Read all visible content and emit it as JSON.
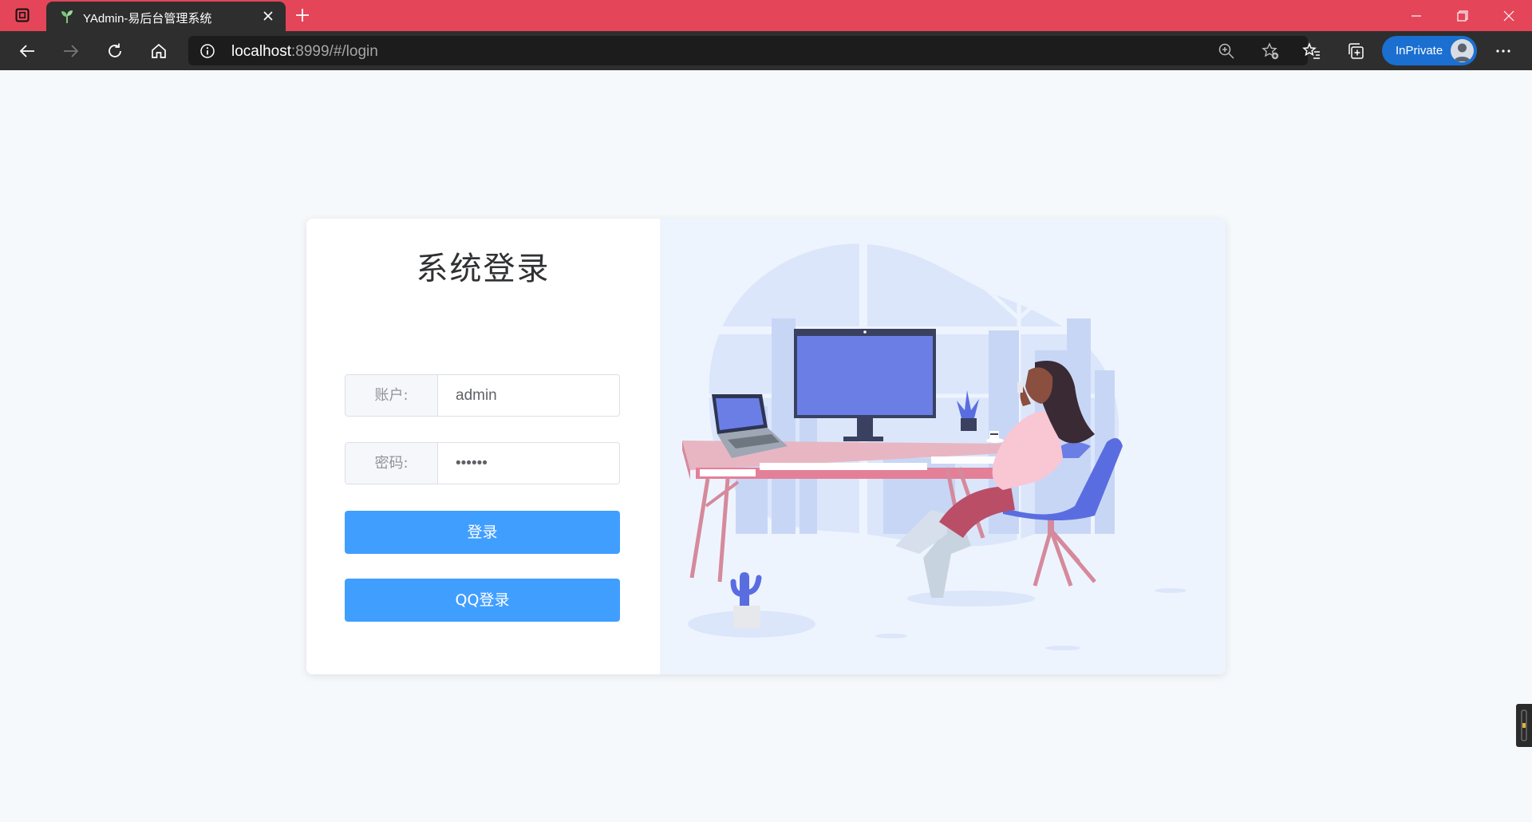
{
  "browser": {
    "tab_title": "YAdmin-易后台管理系统",
    "url_host": "localhost",
    "url_rest": ":8999/#/login",
    "inprivate_label": "InPrivate"
  },
  "login": {
    "title": "系统登录",
    "account_label": "账户:",
    "account_value": "admin",
    "password_label": "密码:",
    "password_value": "••••••",
    "login_button": "登录",
    "qq_login_button": "QQ登录"
  },
  "colors": {
    "titlebar": "#e44558",
    "toolbar": "#2e2e2e",
    "primary_button": "#409eff",
    "illustration_bg": "#eef4fe",
    "monitor_screen": "#6b7ee6"
  },
  "icons": {
    "window_menu": "window-menu-icon",
    "favicon": "sprout-icon",
    "close_tab": "close-icon",
    "new_tab": "plus-icon",
    "back": "arrow-left-icon",
    "forward": "arrow-right-icon",
    "refresh": "refresh-icon",
    "home": "home-icon",
    "site_info": "info-icon",
    "zoom": "zoom-in-icon",
    "add_favorite": "star-add-icon",
    "favorites": "favorites-icon",
    "collections": "collections-icon",
    "more": "more-icon"
  }
}
